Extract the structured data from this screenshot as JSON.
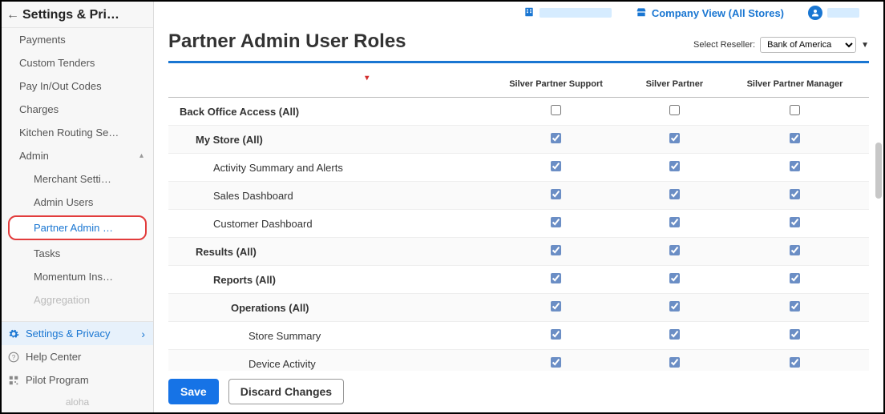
{
  "sidebar": {
    "header_title": "Settings & Pri…",
    "items": [
      {
        "label": "Payments"
      },
      {
        "label": "Custom Tenders"
      },
      {
        "label": "Pay In/Out Codes"
      },
      {
        "label": "Charges"
      },
      {
        "label": "Kitchen Routing Se…"
      },
      {
        "label": "Admin",
        "expandable": true,
        "expanded": true
      },
      {
        "label": "Merchant Setti…",
        "level": 2
      },
      {
        "label": "Admin Users",
        "level": 2
      },
      {
        "label": "Partner Admin …",
        "level": 2,
        "highlighted": true
      },
      {
        "label": "Tasks",
        "level": 2
      },
      {
        "label": "Momentum Ins…",
        "level": 2
      },
      {
        "label": "Aggregation",
        "level": 2,
        "faded": true
      }
    ],
    "bottom": [
      {
        "label": "Settings & Privacy",
        "icon": "gear-icon",
        "active": true
      },
      {
        "label": "Help Center",
        "icon": "help-icon"
      },
      {
        "label": "Pilot Program",
        "icon": "qr-icon"
      }
    ],
    "footer_text": "aloha"
  },
  "topbar": {
    "company_view": "Company View (All Stores)"
  },
  "page": {
    "title": "Partner Admin User Roles",
    "reseller_label": "Select Reseller:",
    "reseller_value": "Bank of America"
  },
  "roles": {
    "columns": [
      "Silver Partner Support",
      "Silver Partner",
      "Silver Partner Manager"
    ],
    "rows": [
      {
        "label": "Back Office Access (All)",
        "indent": 0,
        "bold": true,
        "checks": [
          false,
          false,
          false
        ]
      },
      {
        "label": "My Store (All)",
        "indent": 1,
        "bold": true,
        "checks": [
          true,
          true,
          true
        ]
      },
      {
        "label": "Activity Summary and Alerts",
        "indent": 2,
        "bold": false,
        "checks": [
          true,
          true,
          true
        ]
      },
      {
        "label": "Sales Dashboard",
        "indent": 2,
        "bold": false,
        "checks": [
          true,
          true,
          true
        ]
      },
      {
        "label": "Customer Dashboard",
        "indent": 2,
        "bold": false,
        "checks": [
          true,
          true,
          true
        ]
      },
      {
        "label": "Results (All)",
        "indent": 1,
        "bold": true,
        "checks": [
          true,
          true,
          true
        ]
      },
      {
        "label": "Reports (All)",
        "indent": 2,
        "bold": true,
        "checks": [
          true,
          true,
          true
        ]
      },
      {
        "label": "Operations (All)",
        "indent": 3,
        "bold": true,
        "checks": [
          true,
          true,
          true
        ]
      },
      {
        "label": "Store Summary",
        "indent": 4,
        "bold": false,
        "checks": [
          true,
          true,
          true
        ]
      },
      {
        "label": "Device Activity",
        "indent": 4,
        "bold": false,
        "checks": [
          true,
          true,
          true
        ]
      }
    ]
  },
  "actions": {
    "save": "Save",
    "discard": "Discard Changes"
  }
}
